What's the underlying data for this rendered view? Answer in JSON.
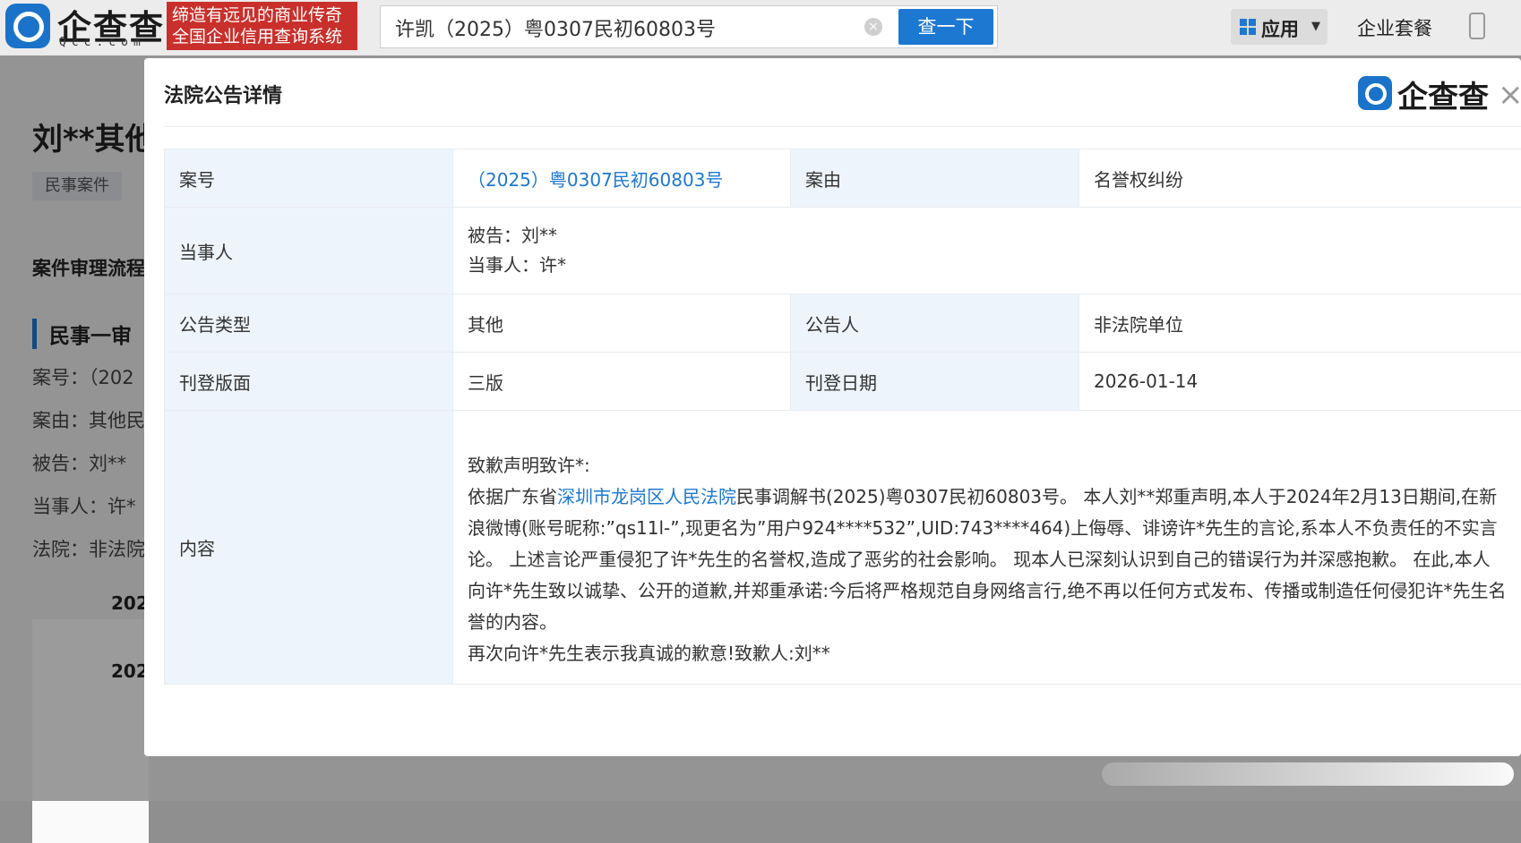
{
  "header": {
    "logo_text": "企查查",
    "logo_sub": "Qcc.com",
    "slogan_line1": "缔造有远见的商业传奇",
    "slogan_line2": "全国企业信用查询系统",
    "search_value": "许凯（2025）粤0307民初60803号",
    "search_button": "查一下",
    "apps_label": "应用",
    "package_label": "企业套餐"
  },
  "background_page": {
    "title": "刘**其他",
    "tag": "民事案件",
    "section_title": "案件审理流程",
    "stage_title": "民事一审",
    "lines": [
      "案号：（202",
      "案由：其他民",
      "被告：刘**",
      "当事人：许*",
      "法院：非法院"
    ],
    "years": [
      "202",
      "202"
    ]
  },
  "modal": {
    "title": "法院公告详情",
    "logo_text": "企查查",
    "rows": {
      "case_no_label": "案号",
      "case_no_value": "（2025）粤0307民初60803号",
      "cause_label": "案由",
      "cause_value": "名誉权纠纷",
      "party_label": "当事人",
      "defendant": "被告：刘**",
      "party": "当事人：许*",
      "type_label": "公告类型",
      "type_value": "其他",
      "announcer_label": "公告人",
      "announcer_value": "非法院单位",
      "page_label": "刊登版面",
      "page_value": "三版",
      "date_label": "刊登日期",
      "date_value": "2026-01-14",
      "content_label": "内容"
    },
    "content": {
      "heading": "致歉声明致许*:",
      "p1_before_link": "依据广东省",
      "p1_link": "深圳市龙岗区人民法院",
      "p1_after_link": "民事调解书(2025)粤0307民初60803号。 本人刘**郑重声明,本人于2024年2月13日期间,在新浪微博(账号昵称:”qs11l-”,现更名为”用户924****532”,UID:743****464)上侮辱、诽谤许*先生的言论,系本人不负责任的不实言论。 上述言论严重侵犯了许*先生的名誉权,造成了恶劣的社会影响。 现本人已深刻认识到自己的错误行为并深感抱歉。 在此,本人向许*先生致以诚挚、公开的道歉,并郑重承诺:今后将严格规范自身网络言行,绝不再以任何方式发布、传播或制造任何侵犯许*先生名誉的内容。",
      "closing": "再次向许*先生表示我真诚的歉意!致歉人:刘**"
    }
  }
}
